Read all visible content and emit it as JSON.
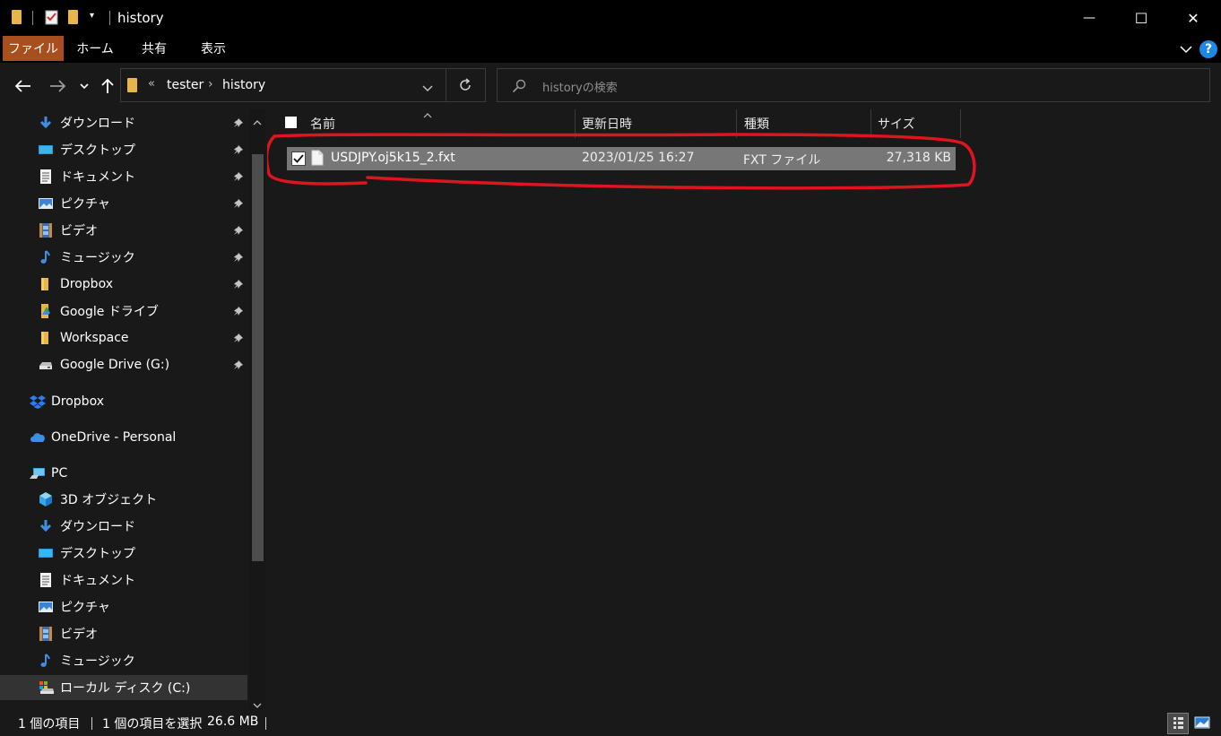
{
  "window": {
    "title": "history",
    "minimize": "—",
    "maximize": "☐",
    "close": "✕"
  },
  "ribbon": {
    "tabs": [
      "ファイル",
      "ホーム",
      "共有",
      "表示"
    ],
    "help": "?"
  },
  "address": {
    "chevron": "«",
    "crumbs": [
      "tester",
      "history"
    ],
    "search_placeholder": "historyの検索"
  },
  "sidebar": {
    "quick_access": [
      {
        "label": "ダウンロード",
        "icon": "download-icon",
        "pinned": true
      },
      {
        "label": "デスクトップ",
        "icon": "desktop-icon",
        "pinned": true
      },
      {
        "label": "ドキュメント",
        "icon": "document-icon",
        "pinned": true
      },
      {
        "label": "ピクチャ",
        "icon": "pictures-icon",
        "pinned": true
      },
      {
        "label": "ビデオ",
        "icon": "video-icon",
        "pinned": true
      },
      {
        "label": "ミュージック",
        "icon": "music-icon",
        "pinned": true
      },
      {
        "label": "Dropbox",
        "icon": "folder-icon",
        "pinned": true
      },
      {
        "label": "Google ドライブ",
        "icon": "google-drive-folder-icon",
        "pinned": true
      },
      {
        "label": "Workspace",
        "icon": "folder-icon",
        "pinned": true
      },
      {
        "label": "Google Drive (G:)",
        "icon": "drive-icon",
        "pinned": true
      }
    ],
    "roots": [
      {
        "label": "Dropbox",
        "icon": "dropbox-icon"
      },
      {
        "label": "OneDrive - Personal",
        "icon": "onedrive-icon"
      },
      {
        "label": "PC",
        "icon": "pc-icon"
      }
    ],
    "pc_items": [
      {
        "label": "3D オブジェクト",
        "icon": "3d-objects-icon"
      },
      {
        "label": "ダウンロード",
        "icon": "download-icon"
      },
      {
        "label": "デスクトップ",
        "icon": "desktop-icon"
      },
      {
        "label": "ドキュメント",
        "icon": "document-icon"
      },
      {
        "label": "ピクチャ",
        "icon": "pictures-icon"
      },
      {
        "label": "ビデオ",
        "icon": "video-icon"
      },
      {
        "label": "ミュージック",
        "icon": "music-icon"
      },
      {
        "label": "ローカル ディスク (C:)",
        "icon": "local-disk-icon"
      }
    ]
  },
  "columns": {
    "name": "名前",
    "modified": "更新日時",
    "type": "種類",
    "size": "サイズ"
  },
  "files": [
    {
      "name": "USDJPY.oj5k15_2.fxt",
      "modified": "2023/01/25 16:27",
      "type": "FXT ファイル",
      "size": "27,318 KB",
      "selected": true
    }
  ],
  "status": {
    "count": "1 個の項目",
    "selected": "1 個の項目を選択",
    "size": "26.6 MB"
  },
  "colors": {
    "accent_file_tab": "#a84f1f",
    "highlight_annotation": "#e0141e",
    "selected_row": "#777777"
  }
}
